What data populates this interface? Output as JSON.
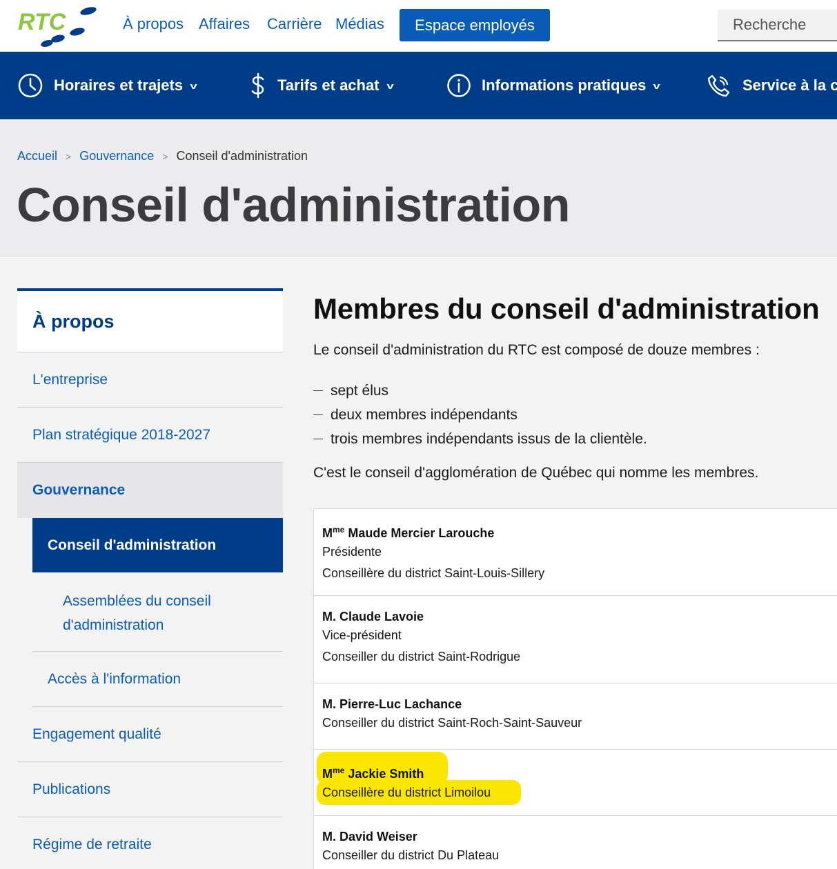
{
  "header": {
    "logo_text": "RTC",
    "nav": [
      "À propos",
      "Affaires",
      "Carrière",
      "Médias"
    ],
    "employee_button": "Espace employés",
    "search_placeholder": "Recherche"
  },
  "main_nav": {
    "items": [
      {
        "label": "Horaires et trajets",
        "icon": "clock-icon"
      },
      {
        "label": "Tarifs et achat",
        "icon": "dollar-icon"
      },
      {
        "label": "Informations pratiques",
        "icon": "info-icon"
      },
      {
        "label": "Service à la cli",
        "icon": "phone-icon"
      }
    ]
  },
  "breadcrumb": [
    "Accueil",
    "Gouvernance",
    "Conseil d'administration"
  ],
  "page_title": "Conseil d'administration",
  "sidebar": {
    "heading": "À propos",
    "items": [
      "L'entreprise",
      "Plan stratégique 2018-2027",
      "Gouvernance",
      "Conseil d'administration",
      "Assemblées du conseil d'administration",
      "Accès à l'information",
      "Engagement qualité",
      "Publications",
      "Régime de retraite"
    ]
  },
  "content": {
    "heading": "Membres du conseil d'administration",
    "intro": "Le conseil d'administration du RTC est composé de douze membres :",
    "bullets": [
      "sept élus",
      "deux membres indépendants",
      "trois membres indépendants issus de la clientèle."
    ],
    "outro": "C'est le conseil d'agglomération de Québec qui nomme les membres."
  },
  "members": [
    {
      "prefix": "M",
      "sup": "me",
      "name": "Maude Mercier Larouche",
      "role": "Présidente",
      "district": "Conseillère du district Saint-Louis-Sillery"
    },
    {
      "prefix": "M.",
      "sup": "",
      "name": "Claude Lavoie",
      "role": "Vice-président",
      "district": "Conseiller du district Saint-Rodrigue"
    },
    {
      "prefix": "M.",
      "sup": "",
      "name": "Pierre-Luc Lachance",
      "role": "",
      "district": "Conseiller du district Saint-Roch-Saint-Sauveur"
    },
    {
      "prefix": "M",
      "sup": "me",
      "name": "Jackie Smith",
      "role": "",
      "district": "Conseillère du district Limoilou"
    },
    {
      "prefix": "M.",
      "sup": "",
      "name": "David Weiser",
      "role": "",
      "district": "Conseiller du district Du Plateau"
    }
  ],
  "colors": {
    "brand_blue": "#003c88",
    "link_blue": "#0a5cb8",
    "highlight": "#fbe600",
    "logo_green": "#8cc63f"
  }
}
